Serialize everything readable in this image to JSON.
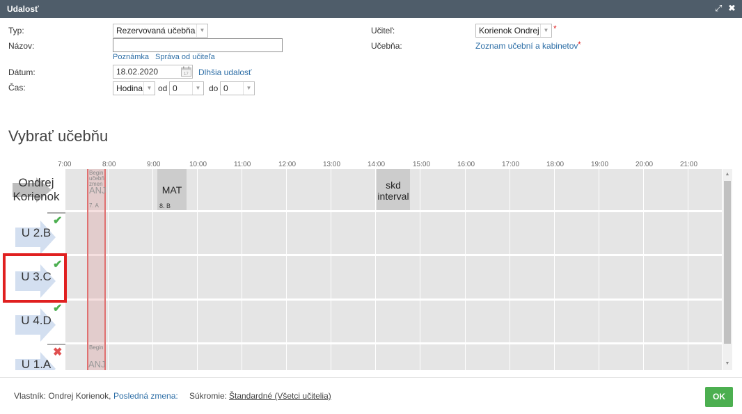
{
  "window": {
    "title": "Udalosť",
    "expand_icon": "expand-icon",
    "close_icon": "close-icon"
  },
  "form": {
    "typ_label": "Typ:",
    "typ_value": "Rezervovaná učebňa",
    "nazov_label": "Názov:",
    "nazov_value": "",
    "poznamka_link": "Poznámka",
    "sprava_link": "Správa od učiteľa",
    "datum_label": "Dátum:",
    "datum_value": "18.02.2020",
    "dlhsia_link": "Dlhšia udalosť",
    "cas_label": "Čas:",
    "cas_unit": "Hodina",
    "od_label": "od",
    "od_value": "0",
    "do_label": "do",
    "do_value": "0",
    "ucitel_label": "Učiteľ:",
    "ucitel_value": "Korienok Ondrej",
    "ucebna_label": "Učebňa:",
    "ucebna_link": "Zoznam učební a kabinetov",
    "required_mark": "*"
  },
  "section": {
    "heading": "Vybrať učebňu"
  },
  "timeline": {
    "hours": [
      "7:00",
      "8:00",
      "9:00",
      "10:00",
      "11:00",
      "12:00",
      "13:00",
      "14:00",
      "15:00",
      "16:00",
      "17:00",
      "18:00",
      "19:00",
      "20:00",
      "21:00"
    ],
    "highlight": {
      "row1_text": [
        "Begin",
        "učebň",
        "zmen",
        "ANJ",
        "7. A"
      ],
      "row5_text": [
        "Begin",
        "ANJ"
      ]
    },
    "rows": [
      {
        "name": "Ondrej\nKorienok",
        "status": "none"
      },
      {
        "name": "U 2.B",
        "status": "ok"
      },
      {
        "name": "U 3.C",
        "status": "ok"
      },
      {
        "name": "U 4.D",
        "status": "ok"
      },
      {
        "name": "U 1.A",
        "status": "conflict"
      }
    ],
    "events": [
      {
        "name": "MAT",
        "class": "8. B"
      },
      {
        "name": "skd\ninterval",
        "class": ""
      }
    ]
  },
  "footer": {
    "owner_label": "Vlastník: Ondrej Korienok,",
    "last_change_link": "Posledná zmena:",
    "privacy_label": "Súkromie:",
    "privacy_value": "Štandardné (Všetci učitelia)",
    "ok_label": "OK"
  },
  "colors": {
    "titlebar": "#4f5d6a",
    "link": "#2d6ea6",
    "ok_button": "#4caf50",
    "selection": "#e02020",
    "grid": "#e5e5e5",
    "event": "#cccccc"
  }
}
